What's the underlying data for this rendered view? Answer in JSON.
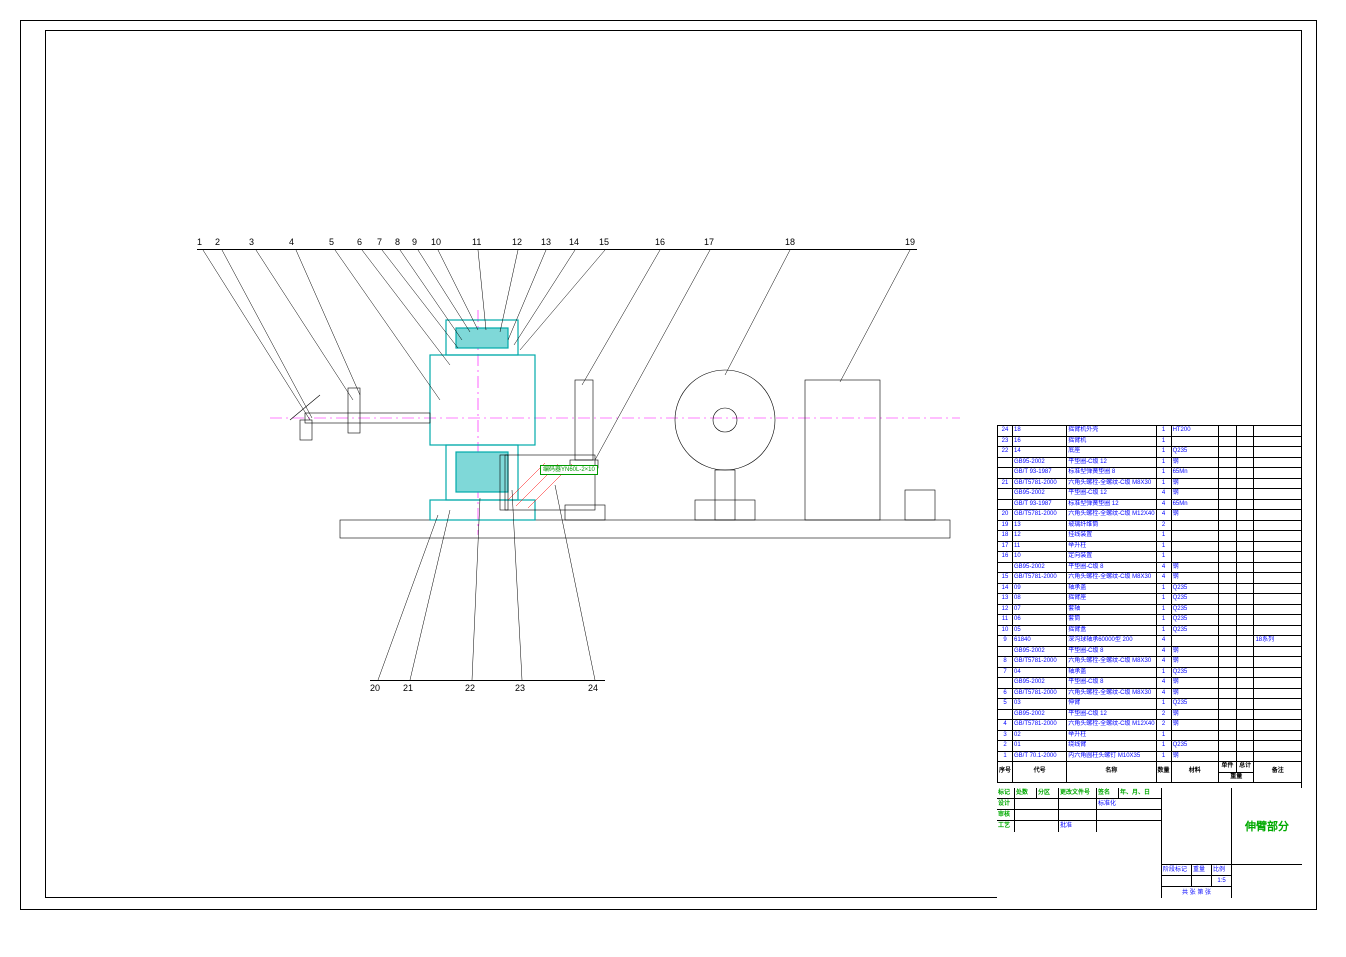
{
  "callouts_top": [
    "1",
    "2",
    "3",
    "4",
    "5",
    "6",
    "7",
    "8",
    "9",
    "10",
    "11",
    "12",
    "13",
    "14",
    "15",
    "16",
    "17",
    "18",
    "19"
  ],
  "callouts_bottom": [
    "20",
    "21",
    "22",
    "23",
    "24"
  ],
  "mech_label": "编码器YN60L-2×10",
  "bom_header": {
    "col1": "序号",
    "col2": "代号",
    "col3": "名称",
    "col4": "数量",
    "col5": "材料",
    "col6": "单件",
    "col7": "总计",
    "weight": "重量",
    "col8": "备注"
  },
  "bom_rows": [
    {
      "n": "24",
      "code": "18",
      "name": "摇臂机外壳",
      "qty": "1",
      "mat": "HT200",
      "w1": "",
      "w2": "",
      "note": ""
    },
    {
      "n": "23",
      "code": "16",
      "name": "摇臂机",
      "qty": "1",
      "mat": "",
      "w1": "",
      "w2": "",
      "note": ""
    },
    {
      "n": "22",
      "code": "14",
      "name": "底座",
      "qty": "1",
      "mat": "Q235",
      "w1": "",
      "w2": "",
      "note": ""
    },
    {
      "n": "",
      "code": "GB95-2002",
      "name": "平垫圈-C级 12",
      "qty": "1",
      "mat": "钢",
      "w1": "",
      "w2": "",
      "note": ""
    },
    {
      "n": "",
      "code": "GB/T 93-1987",
      "name": "标准型弹簧垫圈 8",
      "qty": "1",
      "mat": "65Mn",
      "w1": "",
      "w2": "",
      "note": ""
    },
    {
      "n": "21",
      "code": "GB/T5781-2000",
      "name": "六角头螺栓-全螺纹-C级 M8X30",
      "qty": "1",
      "mat": "钢",
      "w1": "",
      "w2": "",
      "note": ""
    },
    {
      "n": "",
      "code": "GB95-2002",
      "name": "平垫圈-C级 12",
      "qty": "4",
      "mat": "钢",
      "w1": "",
      "w2": "",
      "note": ""
    },
    {
      "n": "",
      "code": "GB/T 93-1987",
      "name": "标准型弹簧垫圈 12",
      "qty": "4",
      "mat": "65Mn",
      "w1": "",
      "w2": "",
      "note": ""
    },
    {
      "n": "20",
      "code": "GB/T5781-2000",
      "name": "六角头螺栓-全螺纹-C级 M12X40",
      "qty": "4",
      "mat": "钢",
      "w1": "",
      "w2": "",
      "note": ""
    },
    {
      "n": "19",
      "code": "13",
      "name": "玻璃纤维筒",
      "qty": "2",
      "mat": "",
      "w1": "",
      "w2": "",
      "note": ""
    },
    {
      "n": "18",
      "code": "12",
      "name": "挂线装置",
      "qty": "1",
      "mat": "",
      "w1": "",
      "w2": "",
      "note": ""
    },
    {
      "n": "17",
      "code": "11",
      "name": "举升柱",
      "qty": "1",
      "mat": "",
      "w1": "",
      "w2": "",
      "note": ""
    },
    {
      "n": "16",
      "code": "10",
      "name": "定向装置",
      "qty": "1",
      "mat": "",
      "w1": "",
      "w2": "",
      "note": ""
    },
    {
      "n": "",
      "code": "GB95-2002",
      "name": "平垫圈-C级 8",
      "qty": "4",
      "mat": "钢",
      "w1": "",
      "w2": "",
      "note": ""
    },
    {
      "n": "15",
      "code": "GB/T5781-2000",
      "name": "六角头螺栓-全螺纹-C级 M8X30",
      "qty": "4",
      "mat": "钢",
      "w1": "",
      "w2": "",
      "note": ""
    },
    {
      "n": "14",
      "code": "09",
      "name": "轴承盖",
      "qty": "1",
      "mat": "Q235",
      "w1": "",
      "w2": "",
      "note": ""
    },
    {
      "n": "13",
      "code": "08",
      "name": "摇臂座",
      "qty": "1",
      "mat": "Q235",
      "w1": "",
      "w2": "",
      "note": ""
    },
    {
      "n": "12",
      "code": "07",
      "name": "套轴",
      "qty": "1",
      "mat": "Q235",
      "w1": "",
      "w2": "",
      "note": ""
    },
    {
      "n": "11",
      "code": "06",
      "name": "套筒",
      "qty": "1",
      "mat": "Q235",
      "w1": "",
      "w2": "",
      "note": ""
    },
    {
      "n": "10",
      "code": "05",
      "name": "摇臂盒",
      "qty": "1",
      "mat": "Q235",
      "w1": "",
      "w2": "",
      "note": ""
    },
    {
      "n": "9",
      "code": "61840",
      "name": "深沟球轴承60000型 200",
      "qty": "4",
      "mat": "",
      "w1": "",
      "w2": "",
      "note": "18系列"
    },
    {
      "n": "",
      "code": "GB95-2002",
      "name": "平垫圈-C级 8",
      "qty": "4",
      "mat": "钢",
      "w1": "",
      "w2": "",
      "note": ""
    },
    {
      "n": "8",
      "code": "GB/T5781-2000",
      "name": "六角头螺栓-全螺纹-C级 M8X30",
      "qty": "4",
      "mat": "钢",
      "w1": "",
      "w2": "",
      "note": ""
    },
    {
      "n": "7",
      "code": "04",
      "name": "轴承盖",
      "qty": "1",
      "mat": "Q235",
      "w1": "",
      "w2": "",
      "note": ""
    },
    {
      "n": "",
      "code": "GB95-2002",
      "name": "平垫圈-C级 8",
      "qty": "4",
      "mat": "钢",
      "w1": "",
      "w2": "",
      "note": ""
    },
    {
      "n": "6",
      "code": "GB/T5781-2000",
      "name": "六角头螺栓-全螺纹-C级 M8X30",
      "qty": "4",
      "mat": "钢",
      "w1": "",
      "w2": "",
      "note": ""
    },
    {
      "n": "5",
      "code": "03",
      "name": "伸臂",
      "qty": "1",
      "mat": "Q235",
      "w1": "",
      "w2": "",
      "note": ""
    },
    {
      "n": "",
      "code": "GB95-2002",
      "name": "平垫圈-C级 12",
      "qty": "2",
      "mat": "钢",
      "w1": "",
      "w2": "",
      "note": ""
    },
    {
      "n": "4",
      "code": "GB/T5781-2000",
      "name": "六角头螺栓-全螺纹-C级 M12X40",
      "qty": "2",
      "mat": "钢",
      "w1": "",
      "w2": "",
      "note": ""
    },
    {
      "n": "3",
      "code": "02",
      "name": "举升柱",
      "qty": "1",
      "mat": "",
      "w1": "",
      "w2": "",
      "note": ""
    },
    {
      "n": "2",
      "code": "01",
      "name": "绕线臂",
      "qty": "1",
      "mat": "Q235",
      "w1": "",
      "w2": "",
      "note": ""
    },
    {
      "n": "1",
      "code": "GB/T 70.1-2000",
      "name": "内六角圆柱头螺钉 M10X35",
      "qty": "1",
      "mat": "钢",
      "w1": "",
      "w2": "",
      "note": ""
    }
  ],
  "title_block": {
    "row_labels_left": [
      "标记",
      "设计",
      "审核",
      "工艺"
    ],
    "row_top": [
      "处数",
      "分区",
      "更改文件号",
      "签名",
      "年、月、日"
    ],
    "std": "标准化",
    "approve": "批准",
    "stage": "阶段标记",
    "weight": "重量",
    "scale": "比例",
    "scale_value": "1:5",
    "sheet": "共  张  第  张",
    "main_title": "伸臂部分"
  }
}
